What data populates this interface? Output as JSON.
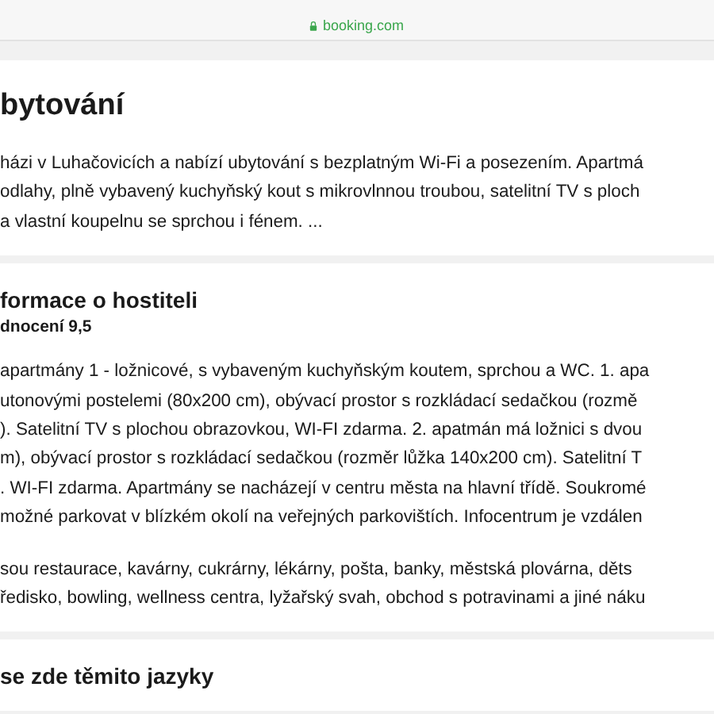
{
  "address_bar": {
    "url": "booking.com",
    "secure": true
  },
  "sections": [
    {
      "title": "bytování",
      "paragraphs": [
        [
          "házi v Luhačovicích a nabízí ubytování s bezplatným Wi-Fi a posezením. Apartmá",
          "odlahy, plně vybavený kuchyňský kout s mikrovlnnou troubou, satelitní TV s ploch",
          "a vlastní koupelnu se sprchou i fénem. ..."
        ]
      ]
    },
    {
      "title": "formace o hostiteli",
      "subtitle": "dnocení 9,5",
      "paragraphs": [
        [
          "apartmány 1 - ložnicové, s vybaveným kuchyňským koutem, sprchou a WC. 1. apa",
          "utonovými postelemi (80x200 cm), obývací prostor s rozkládací sedačkou (rozmě",
          "). Satelitní TV s plochou obrazovkou, WI-FI zdarma. 2. apatmán má ložnici s dvou",
          "m), obývací prostor s rozkládací sedačkou (rozměr lůžka 140x200 cm). Satelitní T",
          ". WI-FI zdarma. Apartmány se nacházejí v centru města na hlavní třídě. Soukromé",
          "možné parkovat v blízkém okolí na veřejných parkovištích. Infocentrum je vzdálen"
        ],
        [
          "sou restaurace, kavárny, cukrárny, lékárny, pošta, banky, městská plovárna, děts",
          "ředisko, bowling, wellness centra, lyžařský svah, obchod s potravinami a jiné náku"
        ]
      ]
    },
    {
      "title": "se zde těmito jazyky"
    }
  ]
}
